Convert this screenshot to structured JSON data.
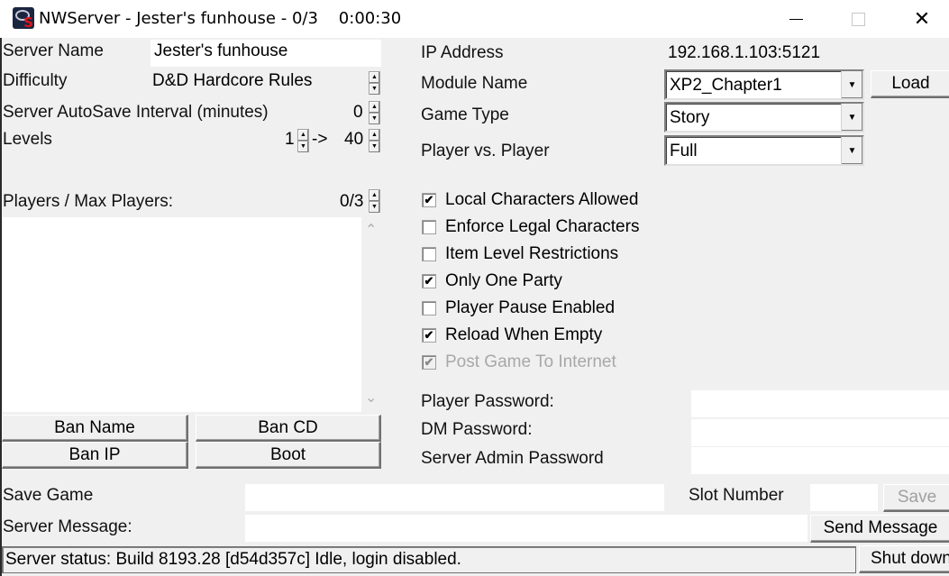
{
  "window": {
    "title": "NWServer - Jester's funhouse - 0/3    0:00:30",
    "icon": "nwserver-app-icon",
    "controls": [
      "minimize",
      "maximize",
      "close"
    ]
  },
  "server": {
    "name_label": "Server Name",
    "name_value": "Jester's funhouse",
    "difficulty_label": "Difficulty",
    "difficulty_value": "D&D Hardcore Rules",
    "autosave_label": "Server AutoSave Interval (minutes)",
    "autosave_value": "0",
    "levels_label": "Levels",
    "levels_min": "1",
    "levels_arrow": "->",
    "levels_max": "40"
  },
  "players": {
    "label": "Players / Max Players:",
    "value": "0/3",
    "list": [],
    "buttons": {
      "ban_name": "Ban Name",
      "ban_cd": "Ban CD",
      "ban_ip": "Ban IP",
      "boot": "Boot"
    }
  },
  "network": {
    "ip_label": "IP Address",
    "ip_value": "192.168.1.103:5121",
    "module_label": "Module Name",
    "module_value": "XP2_Chapter1",
    "load_button": "Load",
    "game_type_label": "Game Type",
    "game_type_value": "Story",
    "pvp_label": "Player vs. Player",
    "pvp_value": "Full"
  },
  "options": [
    {
      "label": "Local Characters Allowed",
      "checked": true,
      "disabled": false
    },
    {
      "label": "Enforce Legal Characters",
      "checked": false,
      "disabled": false
    },
    {
      "label": "Item Level Restrictions",
      "checked": false,
      "disabled": false
    },
    {
      "label": "Only One Party",
      "checked": true,
      "disabled": false
    },
    {
      "label": "Player Pause Enabled",
      "checked": false,
      "disabled": false
    },
    {
      "label": "Reload When Empty",
      "checked": true,
      "disabled": false
    },
    {
      "label": "Post Game To Internet",
      "checked": true,
      "disabled": true
    }
  ],
  "passwords": {
    "player_label": "Player Password:",
    "player_value": "",
    "dm_label": "DM Password:",
    "dm_value": "",
    "admin_label": "Server Admin Password",
    "admin_value": ""
  },
  "bottom": {
    "save_game_label": "Save Game",
    "save_game_value": "",
    "slot_label": "Slot Number",
    "slot_value": "",
    "save_button": "Save",
    "message_label": "Server Message:",
    "message_value": "",
    "send_button": "Send Message",
    "status_text": "Server status: Build 8193.28 [d54d357c] Idle, login disabled.",
    "shutdown_button": "Shut down"
  },
  "glyphs": {
    "check": "✔",
    "up": "▲",
    "down": "▼",
    "scroll_up": "⌃",
    "scroll_down": "⌄",
    "close": "✕"
  }
}
